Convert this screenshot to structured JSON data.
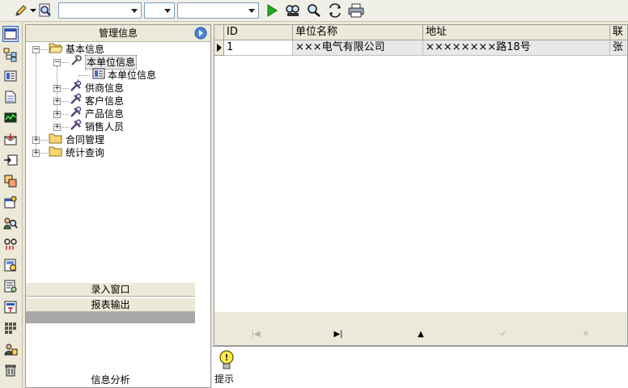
{
  "toolbar": {
    "combo1_value": "",
    "combo2_value": "",
    "combo3_value": ""
  },
  "left_panel": {
    "header": "管理信息",
    "tree": {
      "basic_info": "基本信息",
      "company_info": "本单位信息",
      "company_info_leaf": "本单位信息",
      "supplier_info": "供商信息",
      "customer_info": "客户信息",
      "product_info": "产品信息",
      "sales_staff": "销售人员",
      "contract_mgmt": "合同管理",
      "stats_query": "统计查询"
    },
    "sections": {
      "entry_window": "录入窗口",
      "report_output": "报表输出",
      "info_analysis": "信息分析"
    }
  },
  "grid": {
    "columns": [
      "ID",
      "单位名称",
      "地址",
      "联"
    ],
    "rows": [
      [
        "1",
        "×××电气有限公司",
        "××××××××路18号",
        "张"
      ]
    ]
  },
  "navigator": {
    "first": "|◀",
    "last": "▶|",
    "insert": "▲",
    "post": "✓",
    "cancel": "✕"
  },
  "hint": {
    "label": "提示"
  },
  "colors": {
    "window_bg": "#ece9d8",
    "selection_border": "#316ac5",
    "play_green": "#22aa22"
  }
}
